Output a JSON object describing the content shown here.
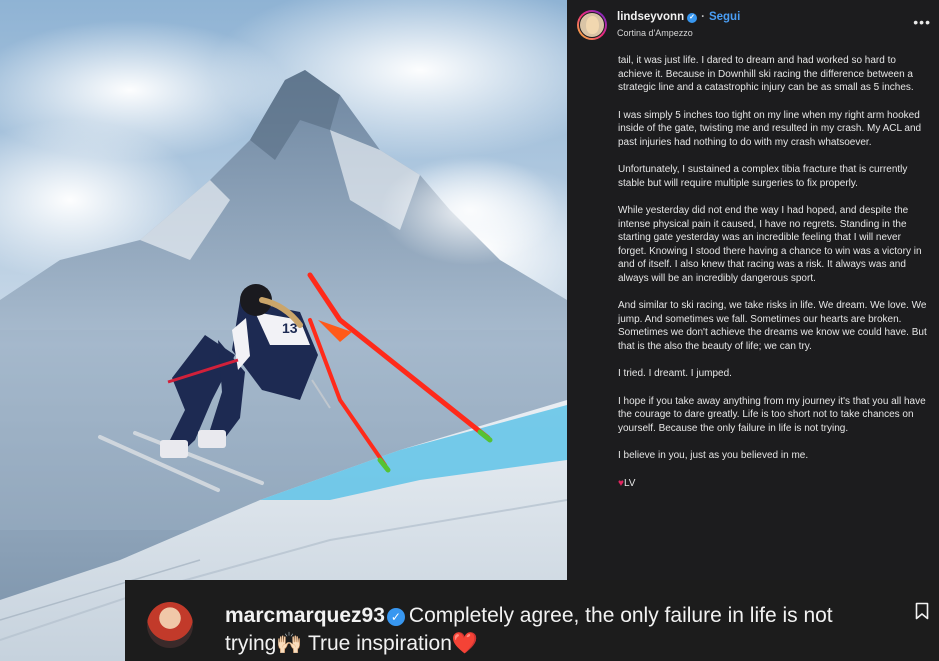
{
  "post": {
    "username": "lindseyvonn",
    "follow_label": "Segui",
    "location": "Cortina d'Ampezzo",
    "more_label": "•••",
    "caption": [
      "tail, it was just life. I dared to dream and had worked so hard to achieve it. Because in Downhill ski racing the difference between a strategic line and a catastrophic injury can be as small as 5 inches.",
      "I was simply 5 inches too tight on my line when my right arm hooked inside of the gate, twisting me and resulted in my crash. My ACL and past injuries had nothing to do with my crash whatsoever.",
      "Unfortunately, I sustained a complex tibia fracture that is currently stable but will require multiple surgeries to fix properly.",
      "While yesterday did not end the way I had hoped, and despite the intense physical pain it caused, I have no regrets. Standing in the starting gate yesterday was an incredible feeling that I will never forget. Knowing I stood there having a chance to win was a victory in and of itself. I also knew that racing was a risk. It always was and always will be an incredibly dangerous sport.",
      "And similar to ski racing, we take risks in life. We dream. We love. We jump. And sometimes we fall. Sometimes our hearts are broken. Sometimes we don't achieve the dreams we know we could have. But that is the also the beauty of life; we can try.",
      "I tried. I dreamt. I jumped.",
      "I hope if you take away anything from my journey it's that you all have the courage to dare greatly. Life is too short not to take chances on yourself. Because the only failure in life is not trying.",
      "I believe in you, just as you believed in me."
    ],
    "signoff_heart": "♥",
    "signoff": "LV",
    "bib_number": "13"
  },
  "comment": {
    "username": "marcmarquez93",
    "text": "Completely agree, the only failure in life is not trying🙌🏻 True inspiration❤️"
  },
  "icons": {
    "verified": "verified-check-icon",
    "more": "more-horizontal-icon",
    "bookmark": "bookmark-icon"
  },
  "colors": {
    "panel_bg": "#1c1c1e",
    "link_blue": "#4a9ef5",
    "verified_blue": "#3897f0",
    "gate_red": "#ff2a1a",
    "gate_green": "#56c234",
    "heart_red": "#e0245e"
  }
}
